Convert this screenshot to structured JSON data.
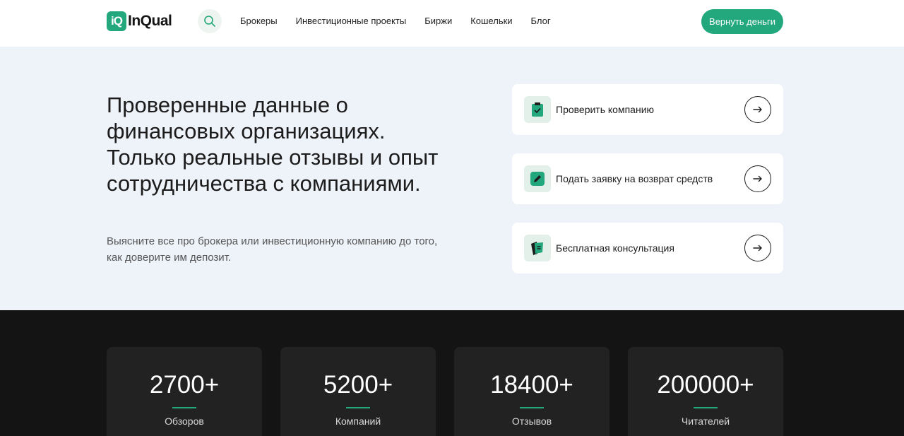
{
  "header": {
    "logo_badge": "iQ",
    "logo_text": "InQual",
    "nav": [
      "Брокеры",
      "Инвестиционные проекты",
      "Биржи",
      "Кошельки",
      "Блог"
    ],
    "cta_label": "Вернуть деньги"
  },
  "hero": {
    "title": "Проверенные данные о финансовых организациях. Только реальные отзывы и опыт сотрудничества с компаниями.",
    "subtitle": "Выясните все про брокера или инвестиционную компанию до того, как доверите им депозит.",
    "cards": [
      {
        "label": "Проверить компанию",
        "icon": "clipboard-check-icon"
      },
      {
        "label": "Подать заявку на возврат средств",
        "icon": "pencil-icon"
      },
      {
        "label": "Бесплатная консультация",
        "icon": "chat-icon"
      }
    ]
  },
  "stats": [
    {
      "value": "2700+",
      "label": "Обзоров"
    },
    {
      "value": "5200+",
      "label": "Компаний"
    },
    {
      "value": "18400+",
      "label": "Отзывов"
    },
    {
      "value": "200000+",
      "label": "Читателей"
    }
  ],
  "colors": {
    "accent": "#23a77c",
    "hero_bg": "#eef2f9",
    "dark_bg": "#141414",
    "stat_card_bg": "#222222"
  }
}
